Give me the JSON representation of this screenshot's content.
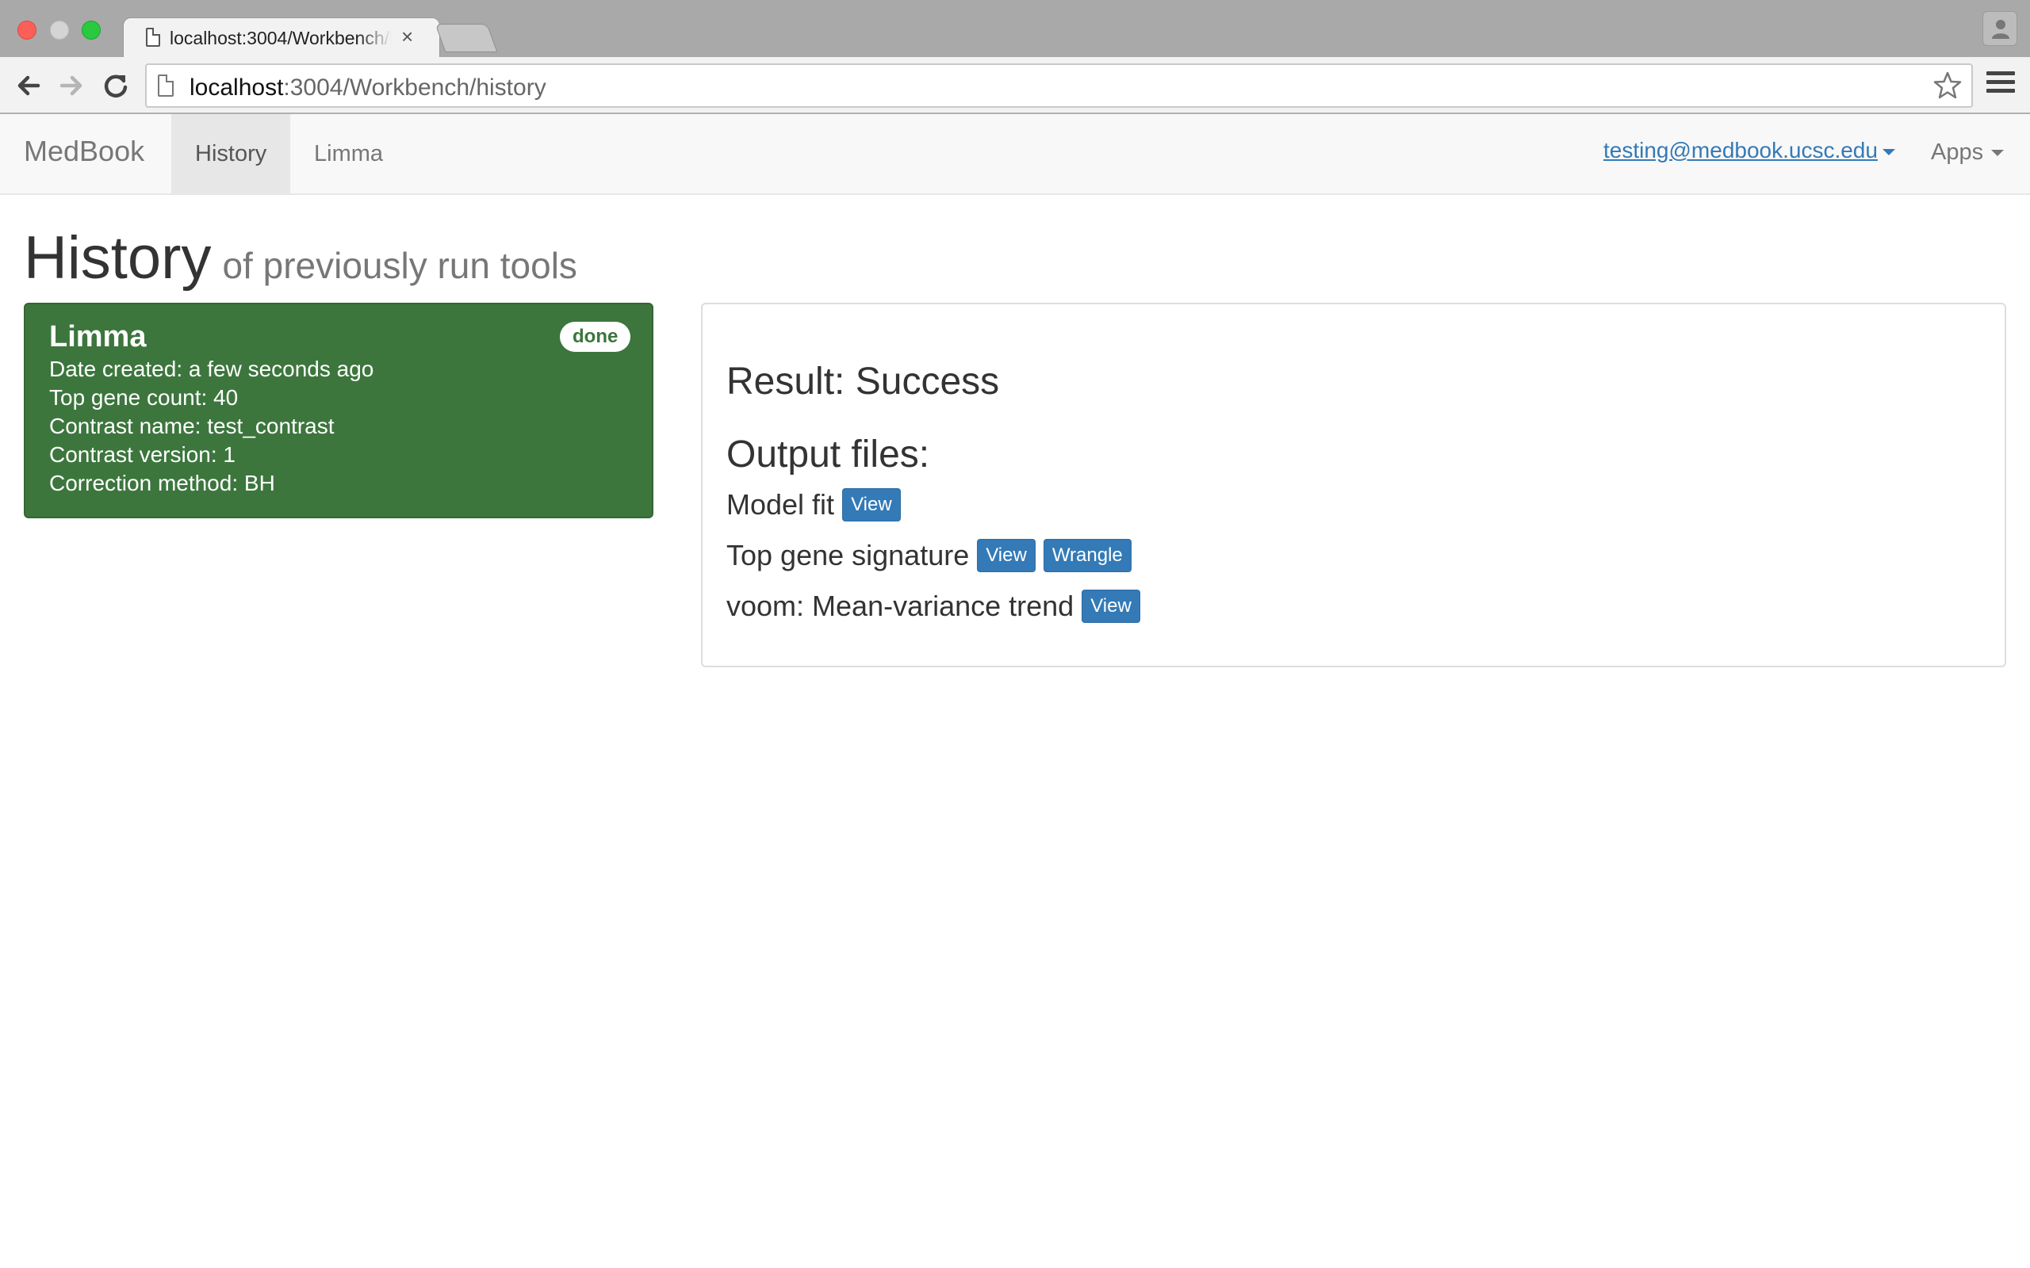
{
  "browser": {
    "tab_title": "localhost:3004/Workbench/history",
    "tab_close": "×",
    "url_host": "localhost",
    "url_path": ":3004/Workbench/history"
  },
  "navbar": {
    "brand": "MedBook",
    "items": [
      {
        "label": "History",
        "active": true
      },
      {
        "label": "Limma",
        "active": false
      }
    ],
    "user_email": "testing@medbook.ucsc.edu",
    "apps_label": "Apps"
  },
  "page": {
    "title": "History",
    "subtitle": "of previously run tools"
  },
  "job": {
    "name": "Limma",
    "status": "done",
    "details": [
      "Date created: a few seconds ago",
      "Top gene count: 40",
      "Contrast name: test_contrast",
      "Contrast version: 1",
      "Correction method: BH"
    ],
    "status_color": "#3c763d"
  },
  "result": {
    "heading": "Result: Success",
    "output_heading": "Output files:",
    "files": [
      {
        "name": "Model fit",
        "buttons": [
          "View"
        ]
      },
      {
        "name": "Top gene signature",
        "buttons": [
          "View",
          "Wrangle"
        ]
      },
      {
        "name": "voom: Mean-variance trend",
        "buttons": [
          "View"
        ]
      }
    ]
  },
  "colors": {
    "primary": "#337ab7",
    "success": "#3c763d"
  }
}
